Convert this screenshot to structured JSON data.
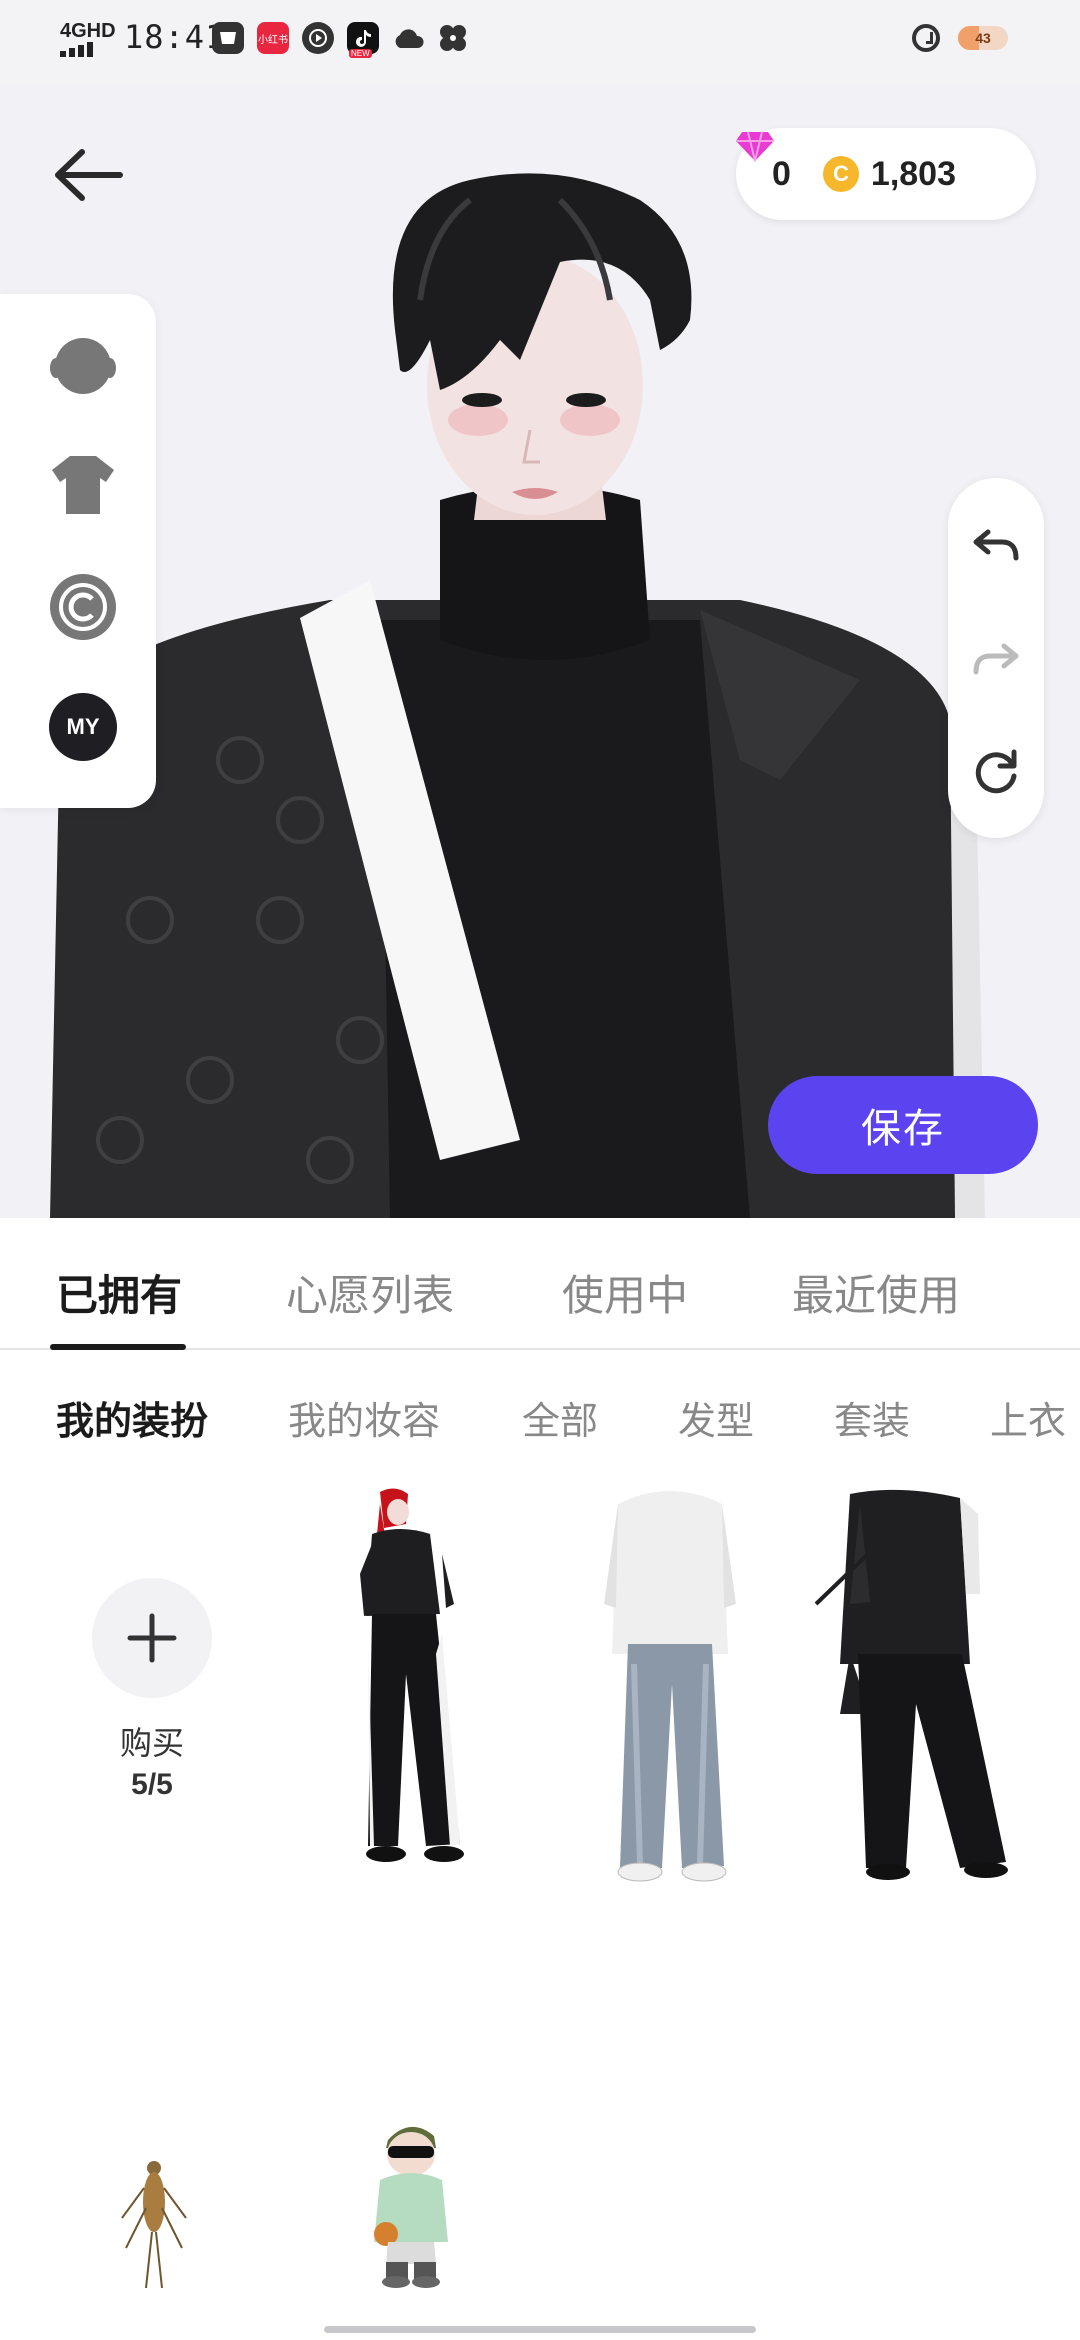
{
  "status_bar": {
    "network": "4GHD",
    "time": "18:41",
    "app_badge_red": "小红书",
    "app_badge_tiktok": "NEW",
    "battery": "43"
  },
  "currency": {
    "diamonds": "0",
    "coin_symbol": "C",
    "coins": "1,803"
  },
  "side_menu": {
    "my_label": "MY"
  },
  "save_label": "保存",
  "tabs": [
    {
      "label": "已拥有"
    },
    {
      "label": "心愿列表"
    },
    {
      "label": "使用中"
    },
    {
      "label": "最近使用"
    }
  ],
  "subtabs": [
    {
      "label": "我的装扮"
    },
    {
      "label": "我的妆容"
    },
    {
      "label": "全部"
    },
    {
      "label": "发型"
    },
    {
      "label": "套装"
    },
    {
      "label": "上衣"
    }
  ],
  "buy_tile": {
    "label": "购买",
    "count": "5/5"
  },
  "outfits": [
    {
      "name": "red-hair-black-outfit"
    },
    {
      "name": "white-hoodie-jeans"
    },
    {
      "name": "black-robe-outfit"
    },
    {
      "name": "insect-item"
    },
    {
      "name": "kid-green-hoodie"
    }
  ]
}
